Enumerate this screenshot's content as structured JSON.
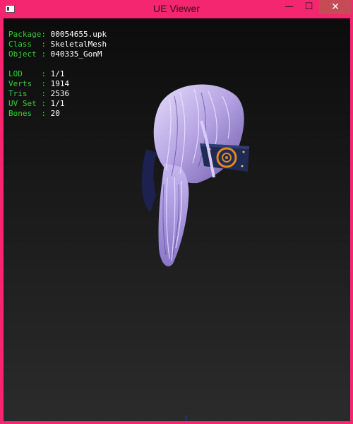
{
  "window": {
    "title": "UE Viewer",
    "controls": {
      "minimize": "—",
      "maximize": "☐",
      "close": "✕"
    }
  },
  "info": {
    "package": {
      "label": "Package",
      "value": "00054655.upk"
    },
    "class": {
      "label": "Class  ",
      "value": "SkeletalMesh"
    },
    "object": {
      "label": "Object ",
      "value": "040335_GonM"
    },
    "lod": {
      "label": "LOD    ",
      "value": "1/1"
    },
    "verts": {
      "label": "Verts  ",
      "value": "1914"
    },
    "tris": {
      "label": "Tris   ",
      "value": "2536"
    },
    "uvset": {
      "label": "UV Set ",
      "value": "1/1"
    },
    "bones": {
      "label": "Bones  ",
      "value": "20"
    }
  },
  "colors": {
    "titlebar": "#f4266f",
    "label_green": "#33d133",
    "value_white": "#ffffff",
    "hair_lavender": "#b9a9e6",
    "band_navy": "#1f2a55",
    "emblem_orange": "#e08a20"
  },
  "icons": {
    "app": "app-icon",
    "model": "hair-mesh"
  }
}
